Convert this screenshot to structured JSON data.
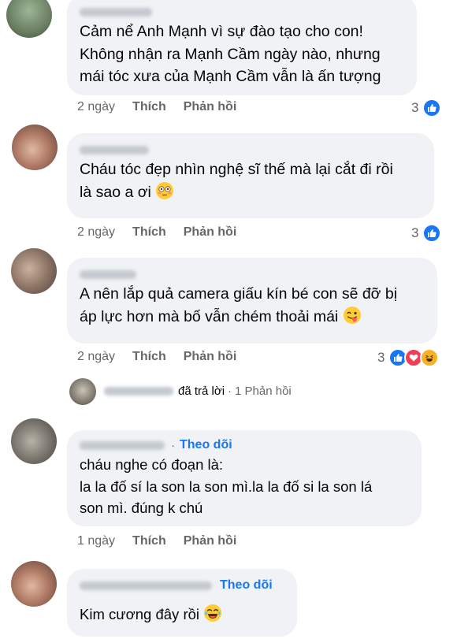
{
  "comments": [
    {
      "text": "Cảm nể Anh Mạnh vì sự đào tạo cho con!\nKhông nhận ra Mạnh Cầm ngày nào, nhưng\nmái tóc xưa của Mạnh Cầm vẫn là ấn tượng",
      "time": "2 ngày",
      "like": "Thích",
      "reply": "Phản hồi",
      "reaction_count": "3",
      "reactions": [
        "like"
      ]
    },
    {
      "text": "Cháu tóc đẹp nhìn nghệ sĩ thế mà lại cắt đi rồi\nlà sao a ơi",
      "emoji": "flushed-emoji",
      "time": "2 ngày",
      "like": "Thích",
      "reply": "Phản hồi",
      "reaction_count": "3",
      "reactions": [
        "like"
      ]
    },
    {
      "text": "A nên lắp quả camera giấu kín bé con sẽ đỡ bị\náp lực hơn mà bố vẫn chém thoải mái",
      "emoji": "tongue-wink-emoji",
      "time": "2 ngày",
      "like": "Thích",
      "reply": "Phản hồi",
      "reaction_count": "3",
      "reactions": [
        "like",
        "love",
        "haha"
      ]
    }
  ],
  "reply_summary": {
    "replied_text": "đã trả lời",
    "separator": "·",
    "count_text": "1 Phản hồi"
  },
  "replies": [
    {
      "follow_dot": "·",
      "follow": "Theo dõi",
      "text": "cháu nghe có đoạn là:\nla la đố sí la son la son mì.la la đố si la son lá\nson mì. đúng k chú",
      "time": "1 ngày",
      "like": "Thích",
      "reply": "Phản hồi"
    },
    {
      "follow": "Theo dõi",
      "text": "Kim cương đây rồi",
      "emoji": "tears-of-joy-emoji"
    }
  ],
  "colors": {
    "bubble": "#f0f2f5",
    "link": "#1877f2",
    "meta": "#65676b",
    "like": "#1877f2",
    "love": "#f33e58",
    "haha": "#f7b125"
  }
}
